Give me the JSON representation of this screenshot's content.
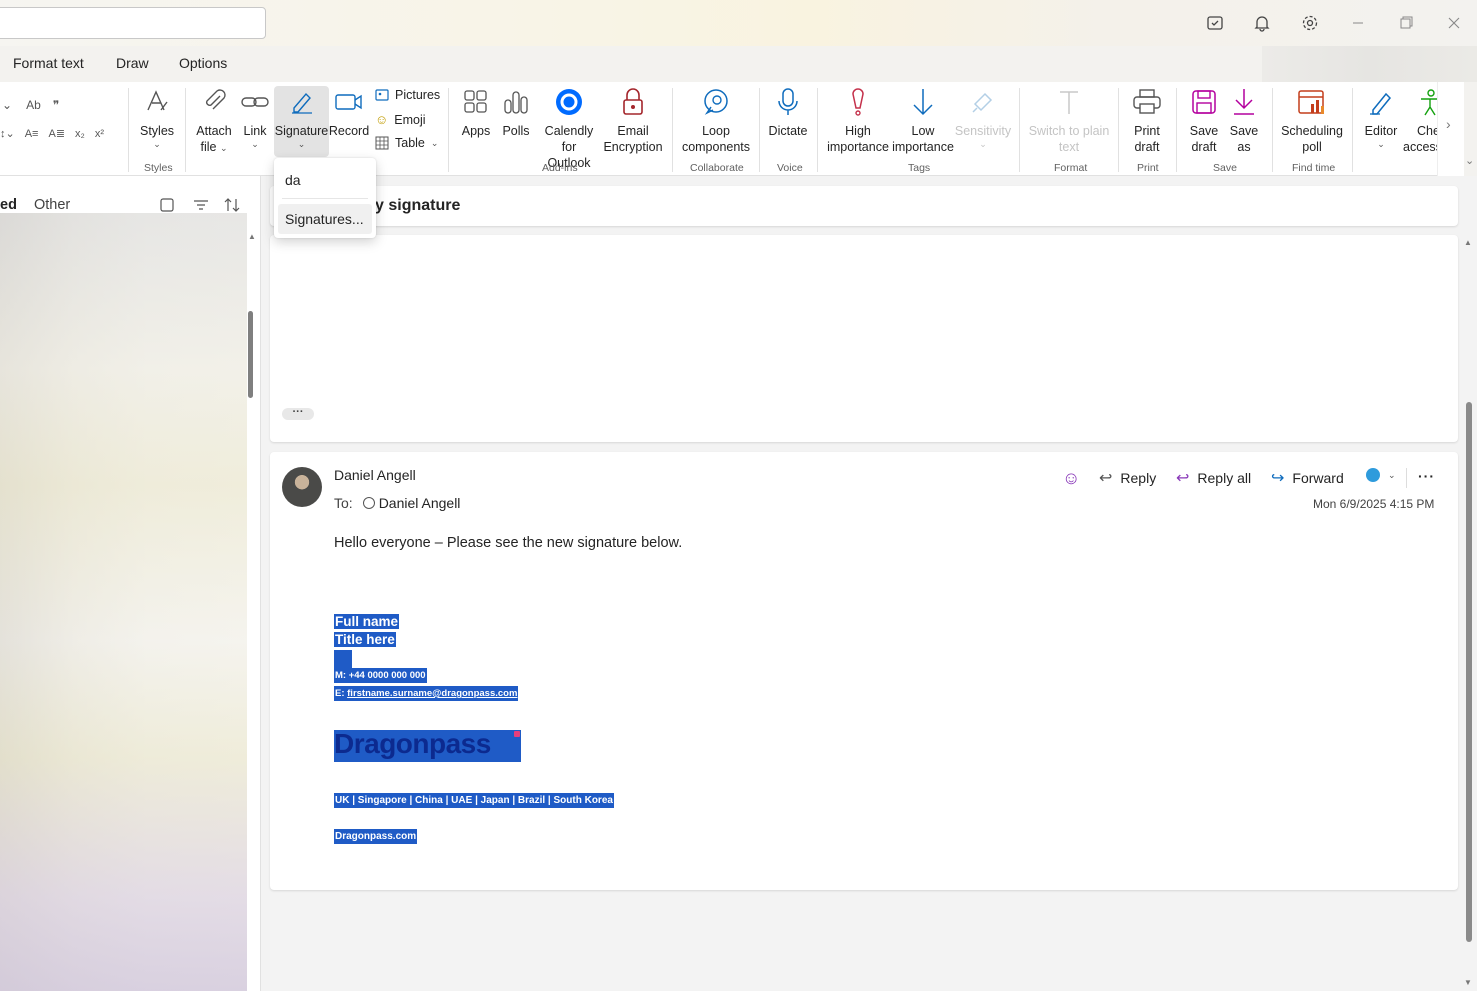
{
  "menu_tabs": [
    "Format text",
    "Draw",
    "Options"
  ],
  "ribbon": {
    "styles": {
      "label": "Styles",
      "group": "Styles"
    },
    "attach": {
      "label1": "Attach",
      "label2": "file"
    },
    "link": {
      "label": "Link"
    },
    "signature": {
      "label": "Signature"
    },
    "record": {
      "label": "Record"
    },
    "pictures": "Pictures",
    "emoji": "Emoji",
    "table": "Table",
    "apps": "Apps",
    "polls": "Polls",
    "calendly": {
      "label1": "Calendly for",
      "label2": "Outlook"
    },
    "email_encryption": {
      "label1": "Email",
      "label2": "Encryption"
    },
    "addins_group": "Add-ins",
    "loop": {
      "label1": "Loop",
      "label2": "components"
    },
    "collaborate_group": "Collaborate",
    "dictate": "Dictate",
    "voice_group": "Voice",
    "high": {
      "label1": "High",
      "label2": "importance"
    },
    "low": {
      "label1": "Low",
      "label2": "importance"
    },
    "sensitivity": "Sensitivity",
    "tags_group": "Tags",
    "plain_text": {
      "label1": "Switch to plain",
      "label2": "text"
    },
    "format_group": "Format",
    "print": {
      "label1": "Print",
      "label2": "draft"
    },
    "print_group": "Print",
    "save_draft": {
      "label1": "Save",
      "label2": "draft"
    },
    "save_as": {
      "label1": "Save",
      "label2": "as"
    },
    "save_group": "Save",
    "scheduling": {
      "label1": "Scheduling",
      "label2": "poll"
    },
    "findtime_group": "Find time",
    "editor": "Editor",
    "accessibility": {
      "label1": "Che",
      "label2": "access"
    }
  },
  "signature_menu": {
    "items": [
      "da",
      "Signatures..."
    ]
  },
  "left_pane": {
    "tab_focused": "ed",
    "tab_other": "Other"
  },
  "conversation": {
    "subject_partial": "y signature"
  },
  "message": {
    "sender": "Daniel Angell",
    "to_label": "To:",
    "recipient": "Daniel Angell",
    "timestamp": "Mon 6/9/2025 4:15 PM",
    "actions": {
      "reply": "Reply",
      "reply_all": "Reply all",
      "forward": "Forward"
    },
    "body_intro": "Hello everyone – Please see the new signature below.",
    "sig": {
      "full_name": "Full name",
      "title": "Title here",
      "mobile": "M: +44 0000 000 000",
      "email_prefix": "E: ",
      "email": "firstname.surname@dragonpass.com",
      "logo": "Dragonpass",
      "locations": "UK | Singapore | China | UAE | Japan | Brazil | South Korea",
      "website": "Dragonpass.com"
    }
  },
  "colors": {
    "accent": "#0f6cbd",
    "selection": "#1f5bc6",
    "logo_blue": "#0c2a8f"
  }
}
